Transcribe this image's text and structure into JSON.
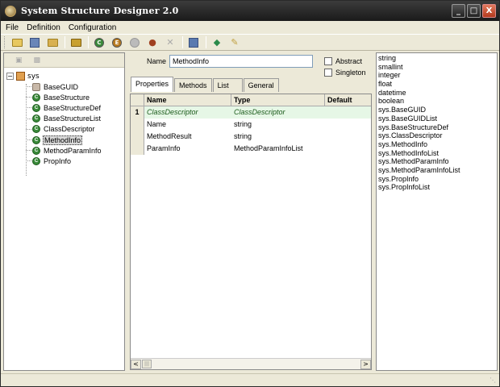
{
  "window": {
    "title": "System Structure Designer 2.0",
    "controls": {
      "minimize": "_",
      "maximize": "□",
      "close": "X"
    }
  },
  "menu": [
    "File",
    "Definition",
    "Configuration"
  ],
  "toolbar": {
    "icons": [
      "open-folder-icon",
      "save-icon",
      "open-project-icon",
      "refresh-icon",
      "add-class-icon",
      "add-enum-icon",
      "add-member-icon",
      "generate-icon",
      "delete-icon",
      "preview-icon",
      "export-icon",
      "edit-icon"
    ]
  },
  "tree": {
    "root": "sys",
    "expander": "−",
    "items": [
      {
        "label": "BaseGUID",
        "kind": "generic"
      },
      {
        "label": "BaseStructure",
        "kind": "class"
      },
      {
        "label": "BaseStructureDef",
        "kind": "class"
      },
      {
        "label": "BaseStructureList",
        "kind": "class"
      },
      {
        "label": "ClassDescriptor",
        "kind": "class"
      },
      {
        "label": "MethodInfo",
        "kind": "class",
        "selected": true
      },
      {
        "label": "MethodParamInfo",
        "kind": "class"
      },
      {
        "label": "PropInfo",
        "kind": "class"
      }
    ]
  },
  "editor": {
    "name_label": "Name",
    "name_value": "MethodInfo",
    "abstract_label": "Abstract",
    "singleton_label": "Singleton",
    "tabs": [
      "Properties",
      "Methods",
      "List",
      "General"
    ],
    "active_tab": "Properties",
    "columns": [
      "Name",
      "Type",
      "Default"
    ],
    "rows": [
      {
        "num": "1",
        "name": "ClassDescriptor",
        "type": "ClassDescriptor",
        "default": "",
        "current": true
      },
      {
        "num": "",
        "name": "Name",
        "type": "string",
        "default": ""
      },
      {
        "num": "",
        "name": "MethodResult",
        "type": "string",
        "default": ""
      },
      {
        "num": "",
        "name": "ParamInfo",
        "type": "MethodParamInfoList",
        "default": ""
      }
    ],
    "scroll_left": "<",
    "scroll_right": ">"
  },
  "types": [
    "string",
    "smallint",
    "integer",
    "float",
    "datetime",
    "boolean",
    "sys.BaseGUID",
    "sys.BaseGUIDList",
    "sys.BaseStructureDef",
    "sys.ClassDescriptor",
    "sys.MethodInfo",
    "sys.MethodInfoList",
    "sys.MethodParamInfo",
    "sys.MethodParamInfoList",
    "sys.PropInfo",
    "sys.PropInfoList"
  ]
}
